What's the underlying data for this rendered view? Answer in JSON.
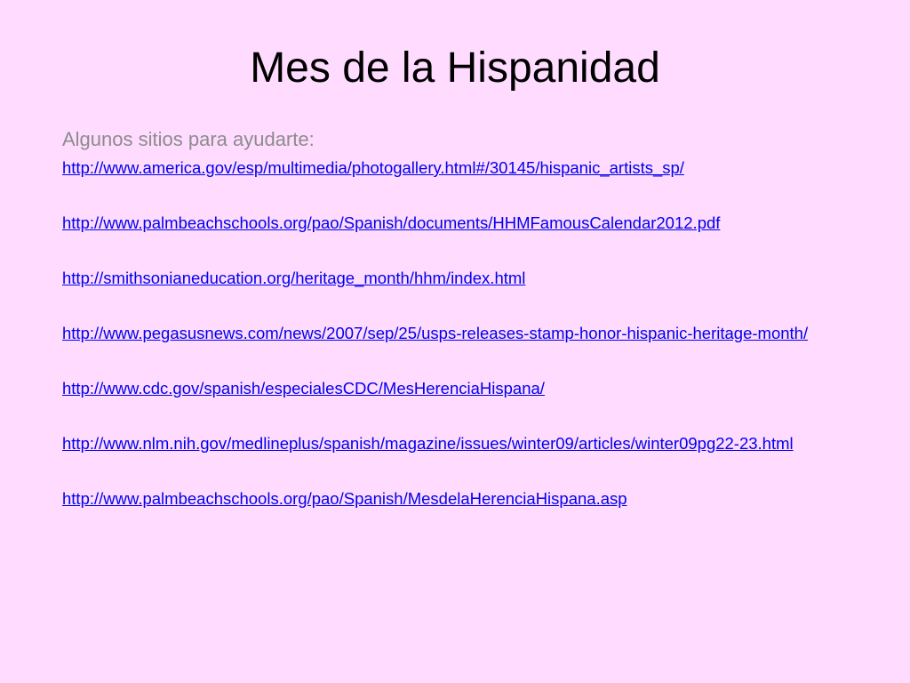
{
  "slide": {
    "title": "Mes de la Hispanidad",
    "intro": "Algunos sitios para ayudarte:",
    "links": [
      "http://www.america.gov/esp/multimedia/photogallery.html#/30145/hispanic_artists_sp/",
      "http://www.palmbeachschools.org/pao/Spanish/documents/HHMFamousCalendar2012.pdf",
      "http://smithsonianeducation.org/heritage_month/hhm/index.html",
      "http://www.pegasusnews.com/news/2007/sep/25/usps-releases-stamp-honor-hispanic-heritage-month/",
      "http://www.cdc.gov/spanish/especialesCDC/MesHerenciaHispana/",
      "http://www.nlm.nih.gov/medlineplus/spanish/magazine/issues/winter09/articles/winter09pg22-23.html",
      "http://www.palmbeachschools.org/pao/Spanish/MesdelaHerenciaHispana.asp"
    ]
  },
  "colors": {
    "background": "#ffdcff",
    "title": "#000000",
    "intro": "#8c8c8c",
    "link": "#0000ee"
  }
}
